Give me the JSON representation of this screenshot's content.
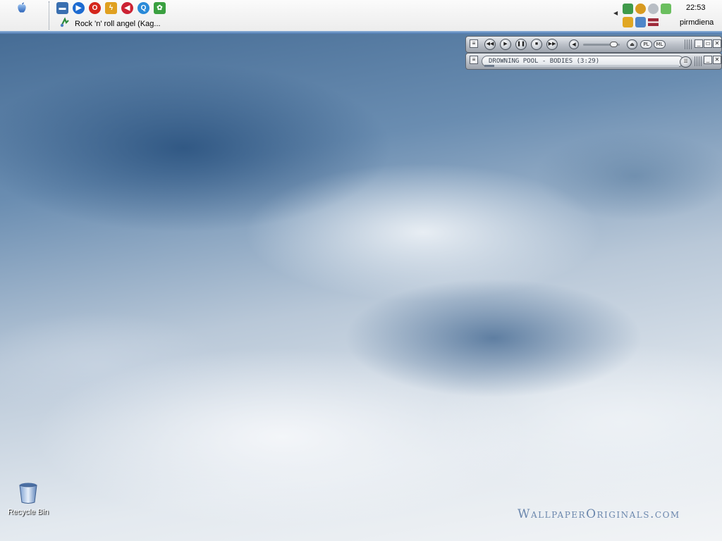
{
  "menubar": {
    "apple_icon": "apple-logo-icon",
    "quick_launch": [
      {
        "icon": "show-desktop-icon",
        "color": "#3a6fb0"
      },
      {
        "icon": "media-player-icon",
        "color": "#1d6bd1"
      },
      {
        "icon": "opera-browser-icon",
        "color": "#d4261c"
      },
      {
        "icon": "winamp-icon",
        "color": "#e0a020"
      },
      {
        "icon": "mute-speaker-icon",
        "color": "#cc2233"
      },
      {
        "icon": "search-icon",
        "color": "#2a8ad8"
      },
      {
        "icon": "messenger-icon",
        "color": "#3aa040"
      }
    ],
    "task": {
      "icon": "winamp-task-icon",
      "label": "Rock 'n' roll angel (Kag..."
    }
  },
  "tray": {
    "icons_top": [
      "msn-buddy-icon",
      "globe-network-icon",
      "disconnected-icon",
      "links-icon"
    ],
    "icons_bottom": [
      "winamp-tray-icon",
      "network-computers-icon",
      "latvian-flag-icon"
    ],
    "clock": "22:53",
    "day": "pirmdiena"
  },
  "winamp": {
    "main_buttons": [
      "previous-icon",
      "play-icon",
      "pause-icon",
      "stop-icon",
      "next-icon"
    ],
    "volume_icon": "volume-icon",
    "volume_level": 0.85,
    "eject_icon": "eject-icon",
    "pl_label": "PL",
    "ml_label": "ML",
    "track_title": "DROWNING POOL - BODIES (3:29)",
    "progress": 0.05
  },
  "desktop": {
    "recycle_bin_label": "Recycle Bin",
    "watermark": "WallpaperOriginals.com"
  }
}
